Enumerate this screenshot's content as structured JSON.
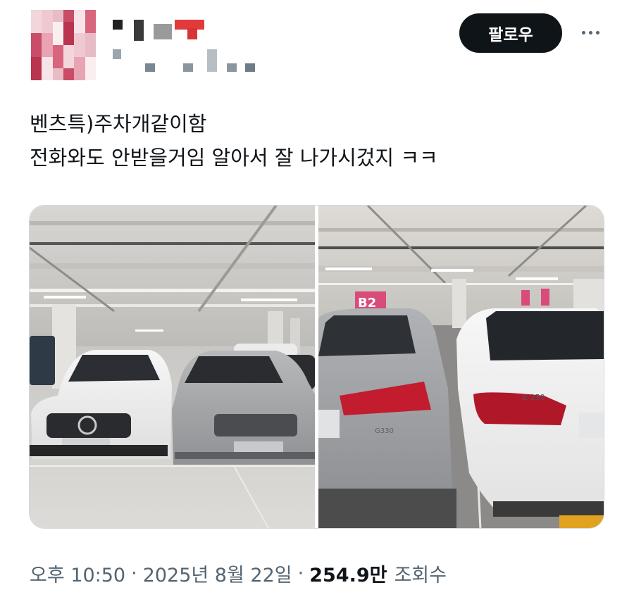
{
  "header": {
    "follow_label": "팔로우",
    "more_icon": "more-horizontal-icon"
  },
  "tweet": {
    "lines": [
      "벤츠특)주차개같이함",
      "전화와도 안받을거임 알아서 잘 나가시겄지 ㅋㅋ"
    ]
  },
  "meta": {
    "time": "오후 10:50",
    "separator": "·",
    "date": "2025년 8월 22일",
    "views_count": "254.9만",
    "views_label": "조회수"
  },
  "media": {
    "left_photo": {
      "sign_text": "",
      "car_badge": ""
    },
    "right_photo": {
      "zone_sign": "B2",
      "badge_left": "G330",
      "badge_right": "E 250"
    }
  },
  "colors": {
    "follow_bg": "#0f1419",
    "text": "#0f1419",
    "secondary": "#536471",
    "border": "#cfd9de"
  }
}
